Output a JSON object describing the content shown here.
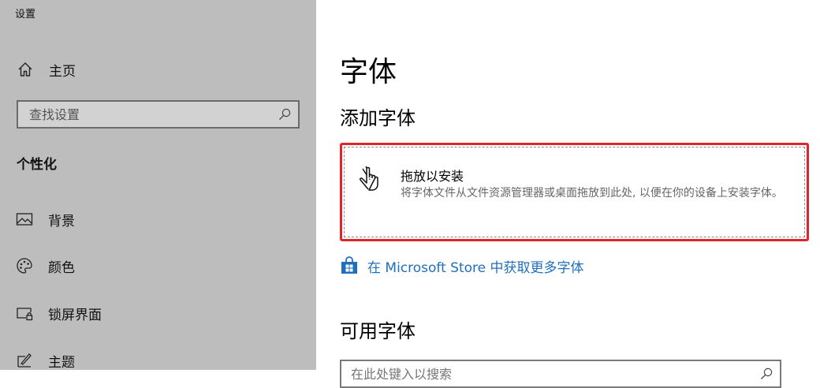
{
  "window": {
    "title": "设置"
  },
  "sidebar": {
    "home_label": "主页",
    "search_placeholder": "查找设置",
    "section_title": "个性化",
    "items": [
      {
        "label": "背景",
        "icon": "picture-icon"
      },
      {
        "label": "颜色",
        "icon": "palette-icon"
      },
      {
        "label": "锁屏界面",
        "icon": "lock-screen-icon"
      },
      {
        "label": "主题",
        "icon": "theme-brush-icon"
      }
    ]
  },
  "main": {
    "title": "字体",
    "add_fonts_heading": "添加字体",
    "drop_zone": {
      "title": "拖放以安装",
      "description": "将字体文件从文件资源管理器或桌面拖放到此处, 以便在你的设备上安装字体。",
      "highlight_color": "#e0242a"
    },
    "store_link": "在 Microsoft Store 中获取更多字体",
    "available_heading": "可用字体",
    "font_search_placeholder": "在此处键入以搜索"
  },
  "colors": {
    "sidebar_bg": "#bdbdbd",
    "link": "#1f6fbf",
    "accent_store": "#1f6fbf"
  }
}
